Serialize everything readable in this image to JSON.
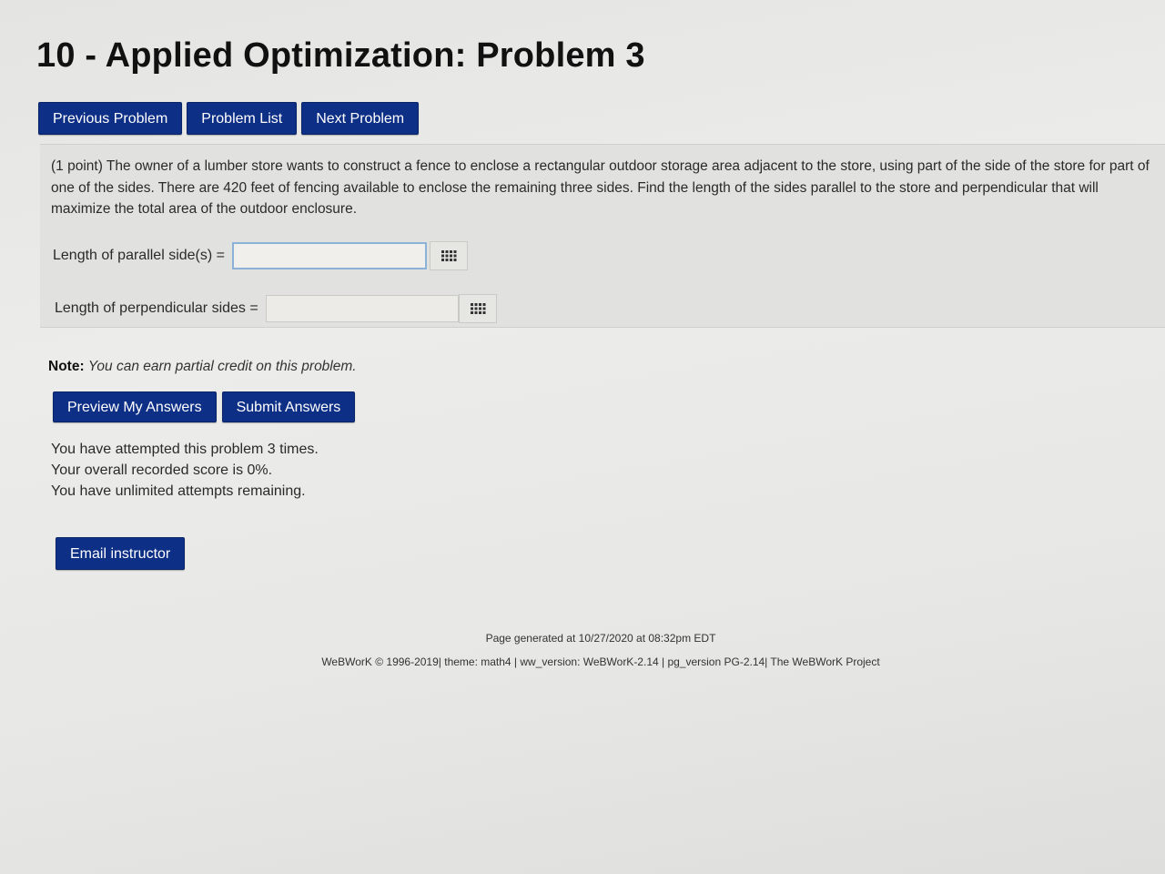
{
  "page": {
    "title": "10 - Applied Optimization: Problem 3"
  },
  "nav": {
    "previous_label": "Previous Problem",
    "list_label": "Problem List",
    "next_label": "Next Problem"
  },
  "problem": {
    "text": "(1 point) The owner of a lumber store wants to construct a fence to enclose a rectangular outdoor storage area adjacent to the store, using part of the side of the store for part of one of the sides. There are 420 feet of fencing available to enclose the remaining three sides. Find the length of the sides parallel to the store and perpendicular that will maximize the total area of the outdoor enclosure.",
    "answers": [
      {
        "label": "Length of parallel side(s) =",
        "value": "",
        "placeholder": ""
      },
      {
        "label": "Length of perpendicular sides =",
        "value": "",
        "placeholder": ""
      }
    ]
  },
  "note": {
    "prefix": "Note:",
    "text": "You can earn partial credit on this problem."
  },
  "actions": {
    "preview_label": "Preview My Answers",
    "submit_label": "Submit Answers",
    "email_label": "Email instructor"
  },
  "status": {
    "attempts": "You have attempted this problem 3 times.",
    "score": "Your overall recorded score is 0%.",
    "remaining": "You have unlimited attempts remaining."
  },
  "footer": {
    "generated": "Page generated at 10/27/2020 at 08:32pm EDT",
    "credits": "WeBWorK © 1996-2019| theme: math4 | ww_version: WeBWorK-2.14 | pg_version PG-2.14| The WeBWorK Project"
  },
  "colors": {
    "button_bg": "#0e2f86",
    "button_text": "#ffffff",
    "focus_border": "#8db2d8"
  },
  "icons": {
    "equation_editor": "grid-icon"
  }
}
